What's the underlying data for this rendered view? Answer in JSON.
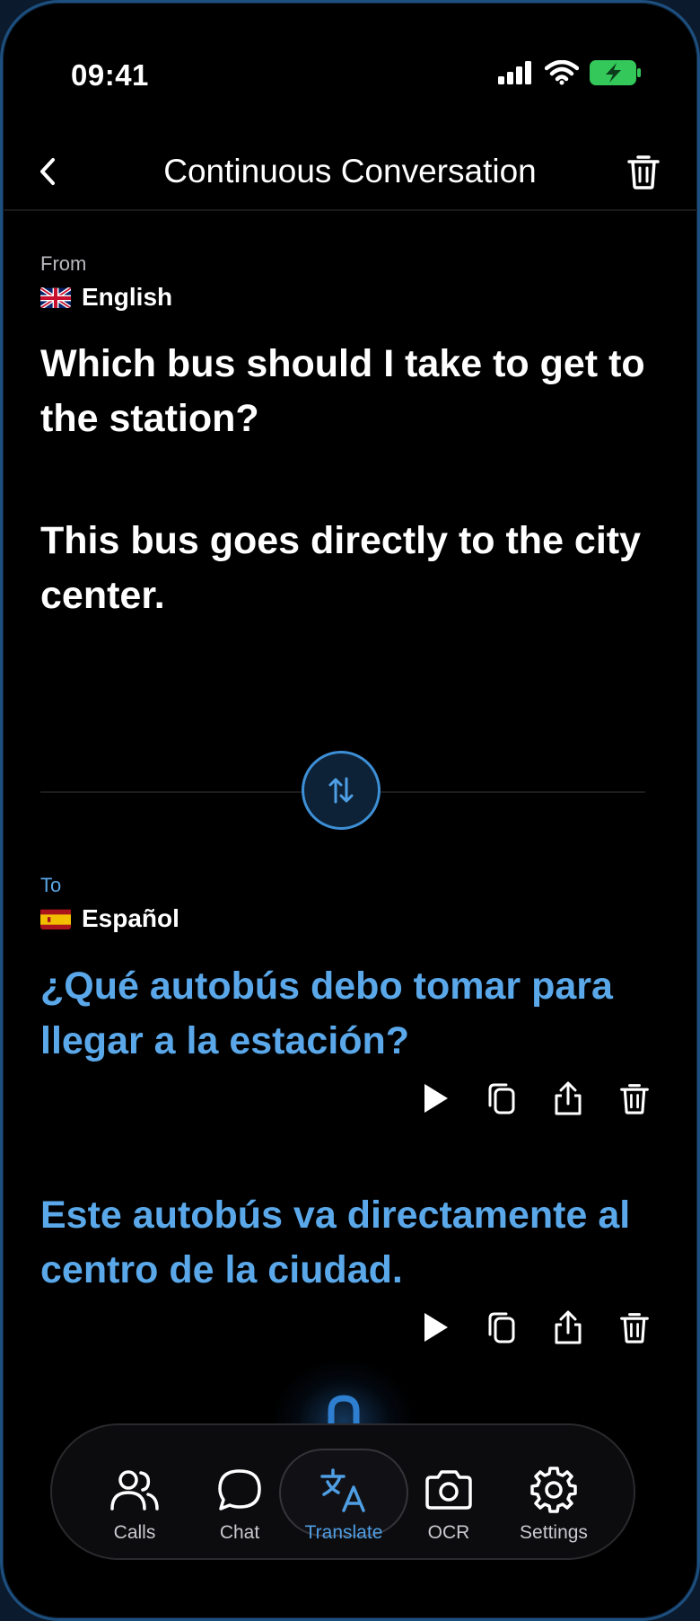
{
  "status_bar": {
    "time": "09:41",
    "icons": [
      "cellular-signal-icon",
      "wifi-icon",
      "battery-charging-icon"
    ],
    "battery_color": "#34c759"
  },
  "header": {
    "title": "Continuous Conversation",
    "back_icon": "chevron-left-icon",
    "trash_icon": "trash-icon"
  },
  "source": {
    "caption": "From",
    "language": "English",
    "flag": "uk-flag",
    "messages": [
      "Which bus should I take to get to the station?",
      "This bus goes directly to the city center."
    ]
  },
  "swap_icon": "swap-arrows-icon",
  "target": {
    "caption": "To",
    "language": "Español",
    "flag": "spain-flag",
    "messages": [
      "¿Qué autobús debo tomar para llegar a la estación?",
      "Este autobús va directamente al centro de la ciudad."
    ],
    "actions": [
      "play-icon",
      "copy-icon",
      "share-icon",
      "trash-icon"
    ]
  },
  "tab_bar": {
    "tabs": [
      {
        "label": "Calls",
        "icon": "users-icon"
      },
      {
        "label": "Chat",
        "icon": "chat-bubble-icon"
      },
      {
        "label": "Translate",
        "icon": "translate-icon"
      },
      {
        "label": "OCR",
        "icon": "camera-icon"
      },
      {
        "label": "Settings",
        "icon": "gear-icon"
      }
    ],
    "active": "Translate"
  },
  "colors": {
    "accent": "#4f9ee4",
    "translated_text": "#5aa8e9",
    "background": "#000000"
  }
}
